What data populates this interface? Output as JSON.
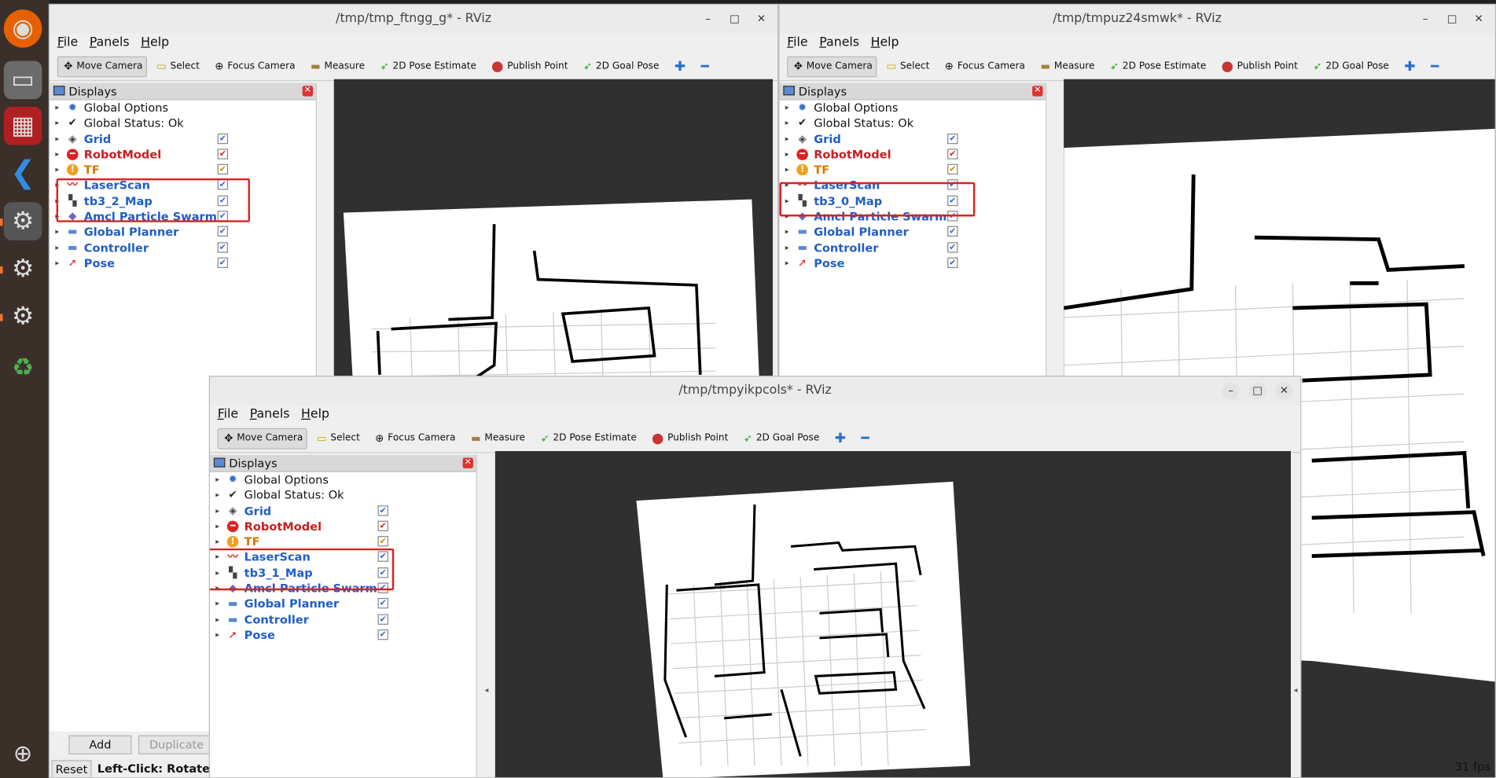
{
  "windows": [
    {
      "id": "w2",
      "title": "/tmp/tmp_ftngg_g* - RViz",
      "map_display": "tb3_2_Map"
    },
    {
      "id": "w0",
      "title": "/tmp/tmpuz24smwk* - RViz",
      "map_display": "tb3_0_Map"
    },
    {
      "id": "w1",
      "title": "/tmp/tmpyikpcols* - RViz",
      "map_display": "tb3_1_Map"
    }
  ],
  "menu": {
    "file": "File",
    "panels": "Panels",
    "help": "Help"
  },
  "toolbar": {
    "move_camera": "Move Camera",
    "select": "Select",
    "focus_camera": "Focus Camera",
    "measure": "Measure",
    "pose_estimate": "2D Pose Estimate",
    "publish_point": "Publish Point",
    "goal_pose": "2D Goal Pose"
  },
  "displays_panel": {
    "title": "Displays"
  },
  "display_items": {
    "global_options": "Global Options",
    "global_status": "Global Status: Ok",
    "grid": "Grid",
    "robot_model": "RobotModel",
    "tf": "TF",
    "laser_scan": "LaserScan",
    "amcl": "Amcl Particle Swarm",
    "global_planner": "Global Planner",
    "controller": "Controller",
    "pose": "Pose"
  },
  "bottom": {
    "add": "Add",
    "duplicate": "Duplicate",
    "rename_partial": "Re",
    "reset": "Reset",
    "hint": "Left-Click: Rotate. M",
    "fps": "31 fps"
  },
  "colors": {
    "annotation_box": "#e02020",
    "display_blue": "#1f5ec8",
    "robotmodel_red": "#c81e1e",
    "tf_orange": "#d77800"
  }
}
